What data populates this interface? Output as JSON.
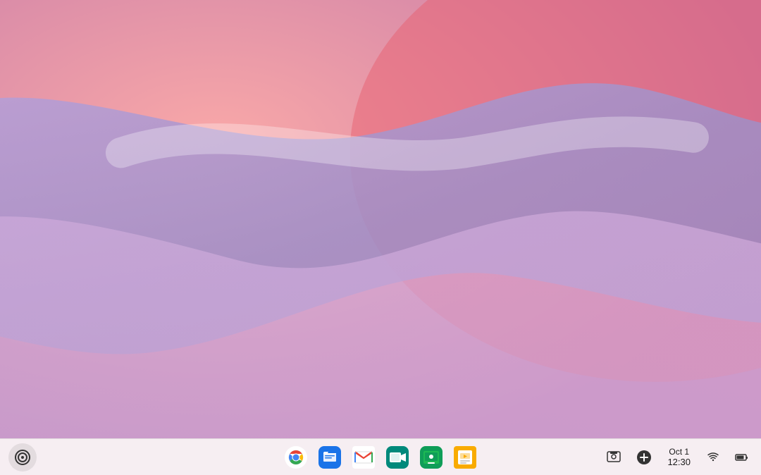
{
  "desktop": {
    "wallpaper_description": "Abstract pink purple wave wallpaper"
  },
  "taskbar": {
    "launcher_label": "Launcher",
    "apps": [
      {
        "name": "Google Chrome",
        "id": "chrome"
      },
      {
        "name": "Files",
        "id": "files"
      },
      {
        "name": "Gmail",
        "id": "gmail"
      },
      {
        "name": "Google Meet",
        "id": "meet"
      },
      {
        "name": "Google Classroom",
        "id": "classroom"
      },
      {
        "name": "Google Slides",
        "id": "slides"
      }
    ],
    "tray": {
      "screen_capture_label": "Screen capture",
      "add_label": "Add",
      "date": "Oct 1",
      "time": "12:30",
      "month_short": "Oct",
      "day": "1",
      "wifi_label": "WiFi",
      "battery_label": "Battery"
    }
  }
}
